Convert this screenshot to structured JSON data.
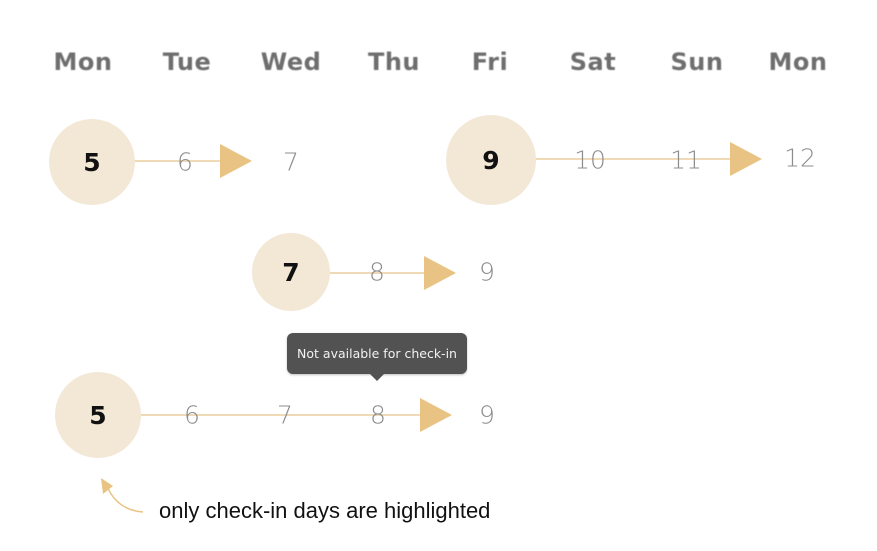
{
  "weekdays": [
    "Mon",
    "Tue",
    "Wed",
    "Thu",
    "Fri",
    "Sat",
    "Sun",
    "Mon"
  ],
  "rows": [
    {
      "checkin": "5",
      "days": [
        "6"
      ],
      "end": "7"
    },
    {
      "checkin": "9",
      "days": [
        "10",
        "11"
      ],
      "end": "12"
    },
    {
      "checkin": "7",
      "days": [
        "8"
      ],
      "end": "9"
    },
    {
      "checkin": "5",
      "days": [
        "6",
        "7",
        "8"
      ],
      "end": "9"
    }
  ],
  "tooltip": {
    "text": "Not available for check-in"
  },
  "note": {
    "text": "only check-in days are highlighted"
  },
  "colors": {
    "highlight": "#f3e8d6",
    "arrow": "#e9c383",
    "line": "#f0d9b5",
    "tooltip_bg": "#525252"
  }
}
